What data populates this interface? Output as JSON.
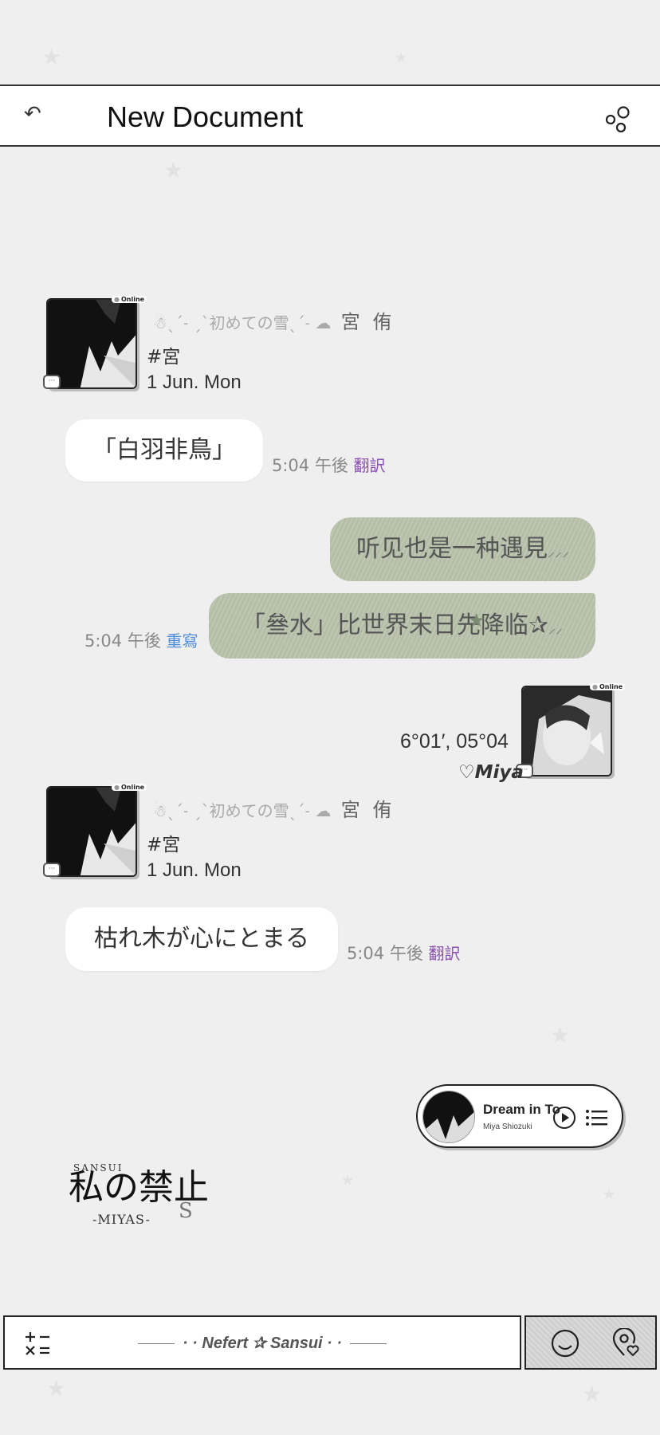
{
  "header": {
    "back_icon": "undo-arrow-icon",
    "title": "New Document",
    "menu_icon": "bubbles-menu-icon"
  },
  "profile_blocks": [
    {
      "online": "Online",
      "snow_text": "☃ˎˊ˗ ˏˋ初めての雪ˎˊ˗ ☁",
      "name": "宮 侑",
      "tag": "#宮",
      "date": "1 Jun. Mon"
    },
    {
      "online": "Online",
      "snow_text": "☃ˎˊ˗ ˏˋ初めての雪ˎˊ˗ ☁",
      "name": "宮 侑",
      "tag": "#宮",
      "date": "1 Jun. Mon"
    }
  ],
  "messages": [
    {
      "text": "「白羽非鳥」",
      "time": "5:04 午後",
      "action": "翻訳"
    },
    {
      "text": "听见也是一种遇見",
      "tail": "⸝⸝⸝"
    },
    {
      "text": "「叄水」比世界末日先降临✰",
      "tail": "⸝⸝",
      "time": "5:04 午後",
      "action": "重寫"
    },
    {
      "text": "枯れ木が心にとまる",
      "time": "5:04 午後",
      "action": "翻訳"
    }
  ],
  "right_profile": {
    "online": "Online",
    "coords": "6°01′, 05°04",
    "name": "♡Miya"
  },
  "music": {
    "title": "Dream in To",
    "artist": "Miya Shiozuki"
  },
  "logo": {
    "top": "SANSUI",
    "kanji": "私の禁止",
    "sub": "-MIYAS-",
    "s": "S"
  },
  "footer": {
    "text": "· · Nefert ✰ Sansui · ·",
    "icons": [
      "calculator-icon",
      "smiley-icon",
      "location-heart-icon"
    ]
  },
  "colors": {
    "green_bubble": "#b4bea7",
    "translate": "#8a4fb0",
    "rewrite": "#4e8ed9"
  }
}
